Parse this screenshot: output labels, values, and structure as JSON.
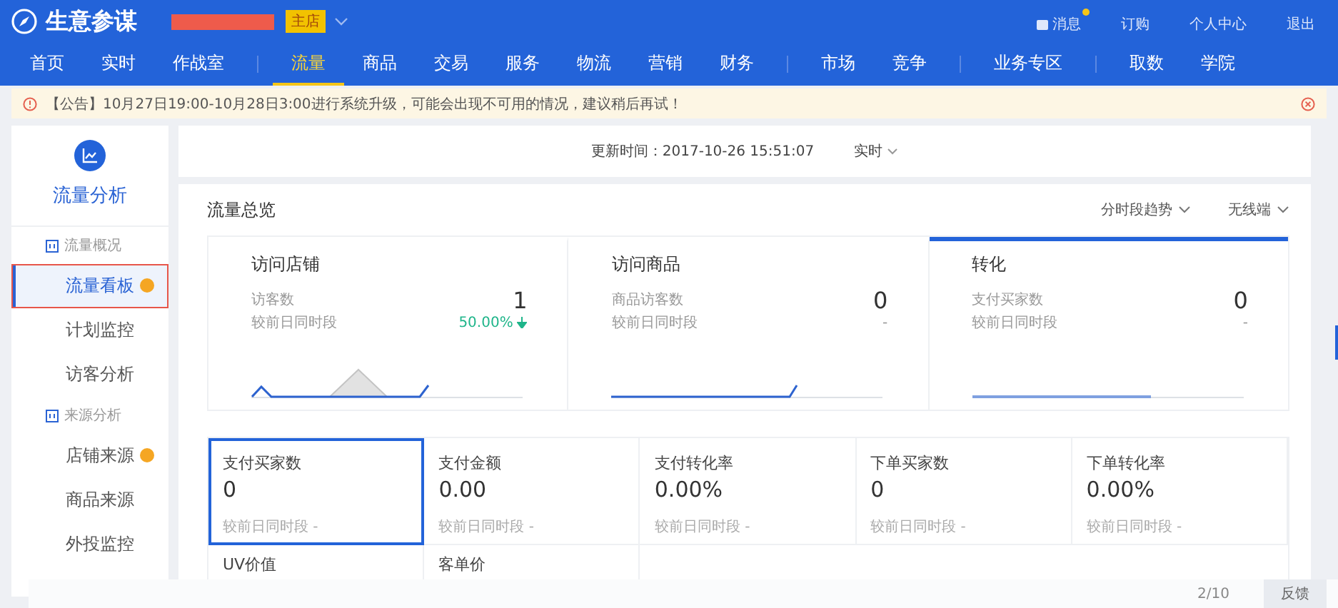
{
  "header": {
    "app_title": "生意参谋",
    "shop_badge": "主店",
    "links": [
      {
        "label": "消息",
        "kind": "message",
        "unread": true
      },
      {
        "label": "订购",
        "kind": "link",
        "unread": false
      },
      {
        "label": "个人中心",
        "kind": "link",
        "unread": false
      },
      {
        "label": "退出",
        "kind": "link",
        "unread": false
      }
    ]
  },
  "nav": {
    "groups": [
      [
        {
          "label": "首页",
          "selected": false
        },
        {
          "label": "实时",
          "selected": false
        },
        {
          "label": "作战室",
          "selected": false
        }
      ],
      [
        {
          "label": "流量",
          "selected": true
        },
        {
          "label": "商品",
          "selected": false
        },
        {
          "label": "交易",
          "selected": false
        },
        {
          "label": "服务",
          "selected": false
        },
        {
          "label": "物流",
          "selected": false
        },
        {
          "label": "营销",
          "selected": false
        },
        {
          "label": "财务",
          "selected": false
        }
      ],
      [
        {
          "label": "市场",
          "selected": false
        },
        {
          "label": "竞争",
          "selected": false
        }
      ],
      [
        {
          "label": "业务专区",
          "selected": false
        }
      ],
      [
        {
          "label": "取数",
          "selected": false
        },
        {
          "label": "学院",
          "selected": false
        }
      ]
    ]
  },
  "notice": {
    "text": "【公告】10月27日19:00-10月28日3:00进行系统升级，可能会出现不可用的情况，建议稍后再试！"
  },
  "sidebar": {
    "title": "流量分析",
    "sections": [
      {
        "heading": "流量概况",
        "items": [
          {
            "label": "流量看板",
            "selected": true,
            "badge": true,
            "outlined": true
          },
          {
            "label": "计划监控",
            "selected": false,
            "badge": false,
            "outlined": false
          },
          {
            "label": "访客分析",
            "selected": false,
            "badge": false,
            "outlined": false
          }
        ]
      },
      {
        "heading": "来源分析",
        "items": [
          {
            "label": "店铺来源",
            "selected": false,
            "badge": true,
            "outlined": false
          },
          {
            "label": "商品来源",
            "selected": false,
            "badge": false,
            "outlined": false
          },
          {
            "label": "外投监控",
            "selected": false,
            "badge": false,
            "outlined": false
          }
        ]
      }
    ]
  },
  "update_bar": {
    "label": "更新时间：2017-10-26 15:51:07",
    "mode": "实时"
  },
  "overview": {
    "title": "流量总览",
    "filters": [
      "分时段趋势",
      "无线端"
    ],
    "cards": [
      {
        "title": "访问店铺",
        "metric": "访客数",
        "value": "1",
        "compare_label": "较前日同时段",
        "change": "50.00%",
        "decrease": true,
        "selected": false,
        "kind": "peaks"
      },
      {
        "title": "访问商品",
        "metric": "商品访客数",
        "value": "0",
        "compare_label": "较前日同时段",
        "change": "-",
        "decrease": false,
        "selected": false,
        "kind": "rise"
      },
      {
        "title": "转化",
        "metric": "支付买家数",
        "value": "0",
        "compare_label": "较前日同时段",
        "change": "-",
        "decrease": false,
        "selected": true,
        "kind": "flat"
      }
    ]
  },
  "metrics": [
    {
      "label": "支付买家数",
      "value": "0",
      "compare_label": "较前日同时段",
      "change": "-",
      "selected": true
    },
    {
      "label": "支付金额",
      "value": "0.00",
      "compare_label": "较前日同时段",
      "change": "-",
      "selected": false
    },
    {
      "label": "支付转化率",
      "value": "0.00%",
      "compare_label": "较前日同时段",
      "change": "-",
      "selected": false
    },
    {
      "label": "下单买家数",
      "value": "0",
      "compare_label": "较前日同时段",
      "change": "-",
      "selected": false
    },
    {
      "label": "下单转化率",
      "value": "0.00%",
      "compare_label": "较前日同时段",
      "change": "-",
      "selected": false
    },
    {
      "label": "UV价值",
      "selected": false
    },
    {
      "label": "客单价",
      "selected": false
    }
  ],
  "footer": {
    "page": "2/10",
    "feedback": "反馈"
  }
}
